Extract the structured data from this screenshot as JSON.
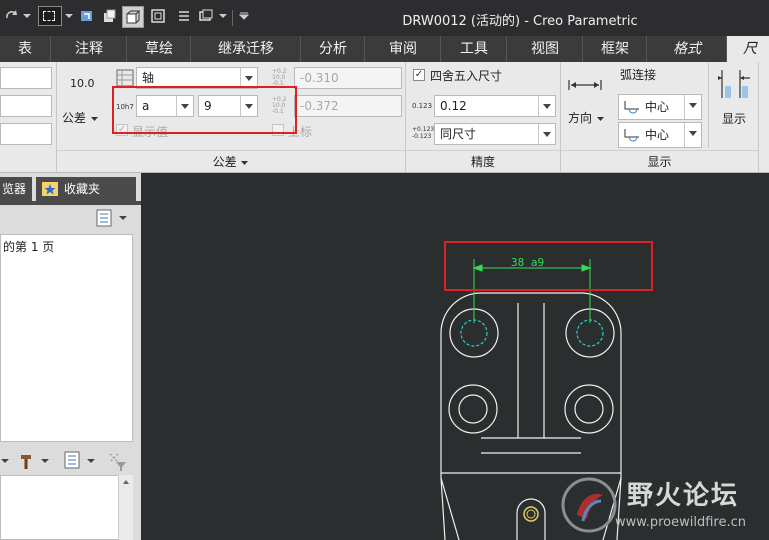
{
  "window": {
    "title": "DRW0012 (活动的) - Creo Parametric"
  },
  "tabs": [
    {
      "label": "表"
    },
    {
      "label": "注释"
    },
    {
      "label": "草绘"
    },
    {
      "label": "继承迁移"
    },
    {
      "label": "分析"
    },
    {
      "label": "审阅"
    },
    {
      "label": "工具"
    },
    {
      "label": "视图"
    },
    {
      "label": "框架"
    },
    {
      "label": "格式"
    },
    {
      "label": "尺寸"
    }
  ],
  "ribbon": {
    "tolerance": {
      "group_label": "公差",
      "nominal_value": "10.0",
      "tolerance_button": "公差",
      "axis_select": "轴",
      "h7_icon_text": "10h7",
      "fit_letter": "a",
      "fit_grade": "9",
      "upper_value": "-0.310",
      "lower_value": "-0.372",
      "show_value_label": "显示值",
      "superscript_label": "上标",
      "upper_icon_text": "+0.2 10.0 -0.1",
      "lower_icon_text": "+0.2 10.0 -0.1",
      "table_icon_text": "10.1"
    },
    "precision": {
      "group_label": "精度",
      "round_label": "四舍五入尺寸",
      "decimal_value": "0.12",
      "tol_decimal_value": "同尺寸",
      "decimal_icon_text": "0.123",
      "tol_icon_text": "+0.123 -0.123"
    },
    "display": {
      "group_label": "显示",
      "direction_label": "方向",
      "arc_label": "弧连接",
      "arc_center_1": "中心",
      "arc_center_2": "中心",
      "show_label": "显示"
    }
  },
  "left_panel": {
    "tab_browser": "览器",
    "tab_favorites": "收藏夹",
    "page_item": "的第 1 页"
  },
  "drawing": {
    "dimension_text": "38 a9"
  },
  "watermark": {
    "title": "野火论坛",
    "url": "www.proewildfire.cn"
  },
  "colors": {
    "highlight_box": "#e02020",
    "dimension": "#33dd55",
    "geometry": "#f0f0f0",
    "hidden_line": "#2ad0d0",
    "canvas": "#2a2e2f"
  }
}
